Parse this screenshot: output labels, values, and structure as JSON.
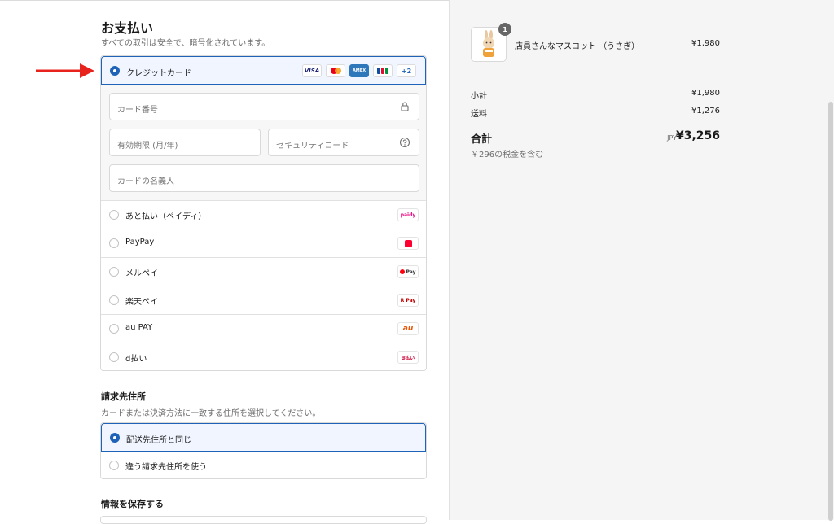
{
  "payment": {
    "title": "お支払い",
    "subtitle": "すべての取引は安全で、暗号化されています。",
    "selected_method": "クレジットカード",
    "card_brands": [
      "VISA",
      "Mastercard",
      "AMEX",
      "JCB"
    ],
    "card_brands_more": "+2",
    "fields": {
      "card_number_placeholder": "カード番号",
      "expiry_placeholder": "有効期限 (月/年)",
      "cvc_placeholder": "セキュリティコード",
      "name_placeholder": "カードの名義人"
    },
    "options": [
      {
        "label": "あと払い（ペイディ）",
        "brand": "paidy",
        "brand_color": "#e5007f"
      },
      {
        "label": "PayPay",
        "brand": "PayPay",
        "brand_color": "#ff0033"
      },
      {
        "label": "メルペイ",
        "brand": "Pay",
        "brand_color": "#ff0211"
      },
      {
        "label": "楽天ペイ",
        "brand": "R Pay",
        "brand_color": "#bf0000"
      },
      {
        "label": "au PAY",
        "brand": "au",
        "brand_color": "#eb5505"
      },
      {
        "label": "d払い",
        "brand": "d払い",
        "brand_color": "#cc0033"
      }
    ]
  },
  "billing": {
    "title": "請求先住所",
    "subtitle": "カードまたは決済方法に一致する住所を選択してください。",
    "options": [
      "配送先住所と同じ",
      "違う請求先住所を使う"
    ]
  },
  "save_info": {
    "title": "情報を保存する"
  },
  "order": {
    "item_name": "店員さんなマスコット （うさぎ）",
    "item_qty": "1",
    "item_price": "¥1,980",
    "subtotal_label": "小計",
    "subtotal": "¥1,980",
    "shipping_label": "送料",
    "shipping": "¥1,276",
    "total_label": "合計",
    "currency": "JPY",
    "total": "¥3,256",
    "tax_note": "￥296の税金を含む"
  },
  "colors": {
    "accent": "#1f63b8",
    "arrow": "#e8231d",
    "summary_bg": "#f5f5f5"
  }
}
